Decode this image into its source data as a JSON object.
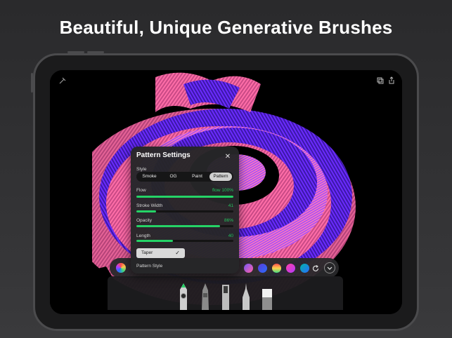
{
  "headline": "Beautiful, Unique Generative Brushes",
  "top_bar": {
    "left_icon": "brush-swirl-icon",
    "right_icons": [
      "layers-icon",
      "share-icon"
    ]
  },
  "pattern_settings": {
    "title": "Pattern Settings",
    "close_icon": "close-icon",
    "style_label": "Style",
    "style_options": [
      "Smoke",
      "OG",
      "Paint",
      "Pattern"
    ],
    "selected_style": "Pattern",
    "sliders": [
      {
        "label": "Flow",
        "value_text": "flow 100%",
        "fraction": 1.0
      },
      {
        "label": "Stroke Width",
        "value_text": "41",
        "fraction": 0.2
      },
      {
        "label": "Opacity",
        "value_text": "86%",
        "fraction": 0.86
      },
      {
        "label": "Length",
        "value_text": "40",
        "fraction": 0.38
      }
    ],
    "taper_label": "Taper",
    "taper_checked": true,
    "pattern_style_label": "Pattern Style"
  },
  "palette": {
    "swatches": [
      {
        "name": "swatch-blue-pink",
        "colors": [
          "#7c5cff",
          "#ff5fa2"
        ]
      },
      {
        "name": "swatch-purple-blue",
        "colors": [
          "#5b3bd6",
          "#2a6cff"
        ]
      },
      {
        "name": "swatch-rainbow",
        "colors": [
          "#ff4d4d",
          "#ffd24d",
          "#3ddc84"
        ]
      },
      {
        "name": "swatch-magenta",
        "colors": [
          "#ff3ea5",
          "#b23bff"
        ]
      },
      {
        "name": "swatch-teal",
        "colors": [
          "#00b3a6",
          "#2a6cff"
        ]
      }
    ],
    "color_wheel_icon": "color-wheel-icon",
    "refresh_icon": "refresh-icon",
    "collapse_icon": "chevron-down-icon"
  },
  "tools": [
    "pen-tool",
    "marker-tool",
    "ink-tool",
    "fineliner-tool",
    "eraser-tool"
  ],
  "colors": {
    "accent": "#25d366",
    "panel": "#262628",
    "art_pink": "#ff6ea8",
    "art_purple": "#6b2bff"
  }
}
